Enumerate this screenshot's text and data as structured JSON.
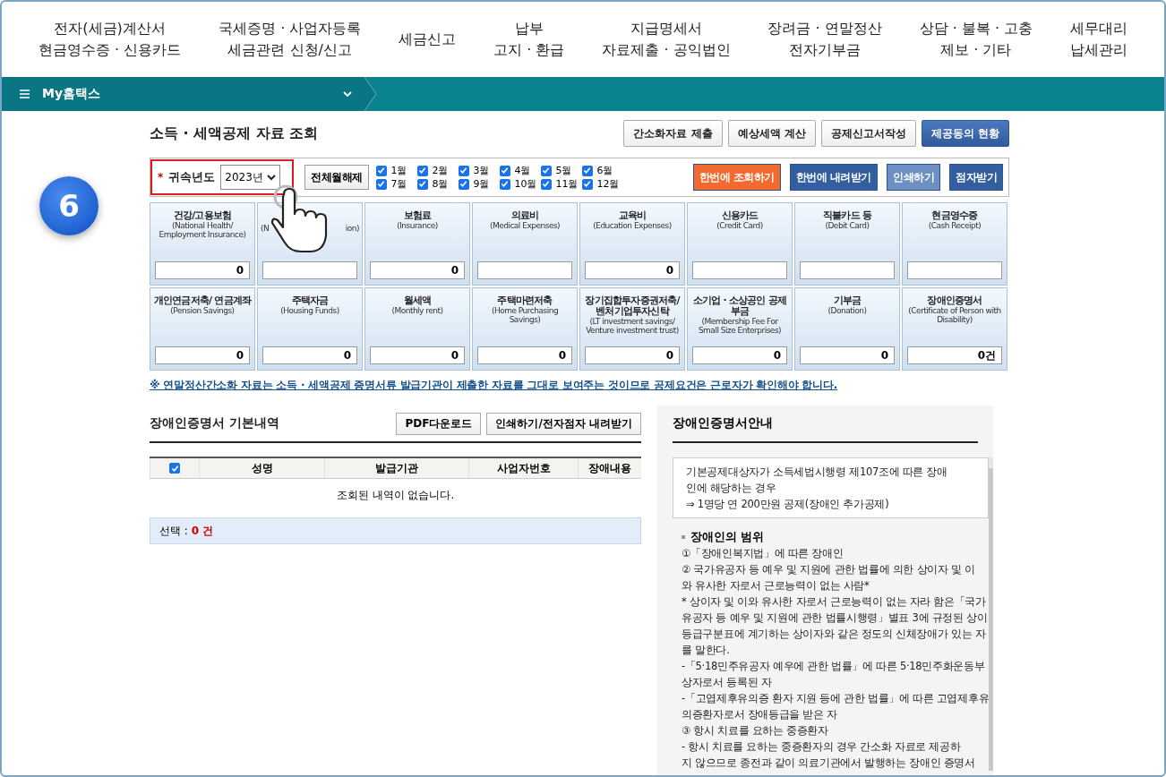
{
  "top_nav": [
    {
      "lines": [
        "전자(세금)계산서",
        "현금영수증 · 신용카드"
      ]
    },
    {
      "lines": [
        "국세증명 · 사업자등록",
        "세금관련 신청/신고"
      ]
    },
    {
      "lines": [
        "세금신고"
      ]
    },
    {
      "lines": [
        "납부",
        "고지 · 환급"
      ]
    },
    {
      "lines": [
        "지급명세서",
        "자료제출 · 공익법인"
      ]
    },
    {
      "lines": [
        "장려금 · 연말정산",
        "전자기부금"
      ]
    },
    {
      "lines": [
        "상담 · 불복 · 고충",
        "제보 · 기타"
      ]
    },
    {
      "lines": [
        "세무대리",
        "납세관리"
      ]
    }
  ],
  "menu_bar": {
    "label": "My홈택스"
  },
  "step_badge": "6",
  "page_title": "소득 · 세액공제 자료 조회",
  "header_buttons": [
    {
      "label": "간소화자료 제출",
      "primary": false
    },
    {
      "label": "예상세액 계산",
      "primary": false
    },
    {
      "label": "공제신고서작성",
      "primary": false
    },
    {
      "label": "제공동의 현황",
      "primary": true
    }
  ],
  "filter": {
    "required_mark": "*",
    "label": "귀속년도",
    "year": "2023년",
    "clear_button": "전체월해제",
    "months": [
      {
        "label": "1월",
        "checked": true
      },
      {
        "label": "2월",
        "checked": true
      },
      {
        "label": "3월",
        "checked": true
      },
      {
        "label": "4월",
        "checked": true
      },
      {
        "label": "5월",
        "checked": true
      },
      {
        "label": "6월",
        "checked": true
      },
      {
        "label": "7월",
        "checked": true
      },
      {
        "label": "8월",
        "checked": true
      },
      {
        "label": "9월",
        "checked": true
      },
      {
        "label": "10월",
        "checked": true
      },
      {
        "label": "11월",
        "checked": true
      },
      {
        "label": "12월",
        "checked": true
      }
    ],
    "actions": [
      {
        "label": "한번에 조회하기",
        "kind": "orange"
      },
      {
        "label": "한번에 내려받기",
        "kind": "blue"
      },
      {
        "label": "인쇄하기",
        "kind": "light"
      },
      {
        "label": "점자받기",
        "kind": "blue"
      }
    ]
  },
  "tiles": [
    {
      "title": "건강/고용보험",
      "subtitle": "(National Health/ Employment Insurance)",
      "value": "0"
    },
    {
      "kind": "covered",
      "subtitle_start": "(N",
      "subtitle_end": "ion)"
    },
    {
      "title": "보험료",
      "subtitle": "(Insurance)",
      "value": "0"
    },
    {
      "title": "의료비",
      "subtitle": "(Medical Expenses)"
    },
    {
      "title": "교육비",
      "subtitle": "(Education Expenses)",
      "value": "0"
    },
    {
      "title": "신용카드",
      "subtitle": "(Credit Card)"
    },
    {
      "title": "직불카드 등",
      "subtitle": "(Debit Card)"
    },
    {
      "title": "현금영수증",
      "subtitle": "(Cash Receipt)"
    },
    {
      "title": "개인연금저축/ 연금계좌",
      "subtitle": "(Pension Savings)",
      "value": "0"
    },
    {
      "title": "주택자금",
      "subtitle": "(Housing Funds)",
      "value": "0"
    },
    {
      "title": "월세액",
      "subtitle": "(Monthly rent)",
      "value": "0"
    },
    {
      "title": "주택마련저축",
      "subtitle": "(Home Purchasing Savings)",
      "value": "0"
    },
    {
      "title": "장기집합투자증권저축/ 벤처기업투자신탁",
      "subtitle": "(LT investment savings/ Venture investment trust)",
      "value": "0"
    },
    {
      "title": "소기업 · 소상공인 공제부금",
      "subtitle": "(Membership Fee For Small Size Enterprises)",
      "value": "0"
    },
    {
      "title": "기부금",
      "subtitle": "(Donation)",
      "value": "0"
    },
    {
      "title": "장애인증명서",
      "subtitle": "(Certificate of Person with Disability)",
      "value": "0건"
    }
  ],
  "notice_link": "※ 연말정산간소화 자료는 소득 · 세액공제 증명서류 발급기관이 제출한 자료를 그대로 보여주는 것이므로 공제요건은 근로자가 확인해야 합니다.",
  "detail": {
    "title": "장애인증명서 기본내역",
    "buttons": [
      "PDF다운로드",
      "인쇄하기/전자점자 내려받기"
    ],
    "select_all_checked": true,
    "columns": [
      "성명",
      "발급기관",
      "사업자번호",
      "장애내용"
    ],
    "empty_message": "조회된 내역이 없습니다.",
    "selection_label": "선택 :",
    "selection_count": "0 건"
  },
  "guide": {
    "title": "장애인증명서안내",
    "summary": [
      "기본공제대상자가 소득세법시행령 제107조에 따른 장애",
      "인에 해당하는 경우",
      "⇒ 1명당 연 200만원 공제(장애인 추가공제)"
    ],
    "section_title": "장애인의 범위",
    "lines": [
      "①「장애인복지법」에 따른 장애인",
      "② 국가유공자 등 예우 및 지원에 관한 법률에 의한 상이자 및 이",
      "와 유사한 자로서 근로능력이 없는 사람*",
      "* 상이자 및 이와 유사한 자로서 근로능력이 없는 자라 함은「국가",
      "유공자 등 예우 및 지원에 관한 법률시행령」별표 3에 규정된 상이",
      "등급구분표에 계기하는 상이자와 같은 정도의 신체장애가 있는 자",
      "를 말한다.",
      "-「5·18민주유공자 예우에 관한 법률」에 따른 5·18민주화운동부",
      "상자로서 등록된 자",
      "-「고엽제후유의증 환자 지원 등에 관한 법률」에 따른 고엽제후유",
      "의증환자로서 장애등급을 받은 자",
      "③ 항시 치료를 요하는 중증환자",
      "- 항시 치료를 요하는 중증환자의 경우 간소화 자료로 제공하",
      "지 않으므로 종전과 같이 의료기관에서 발행하는 장애인 증명서"
    ]
  }
}
